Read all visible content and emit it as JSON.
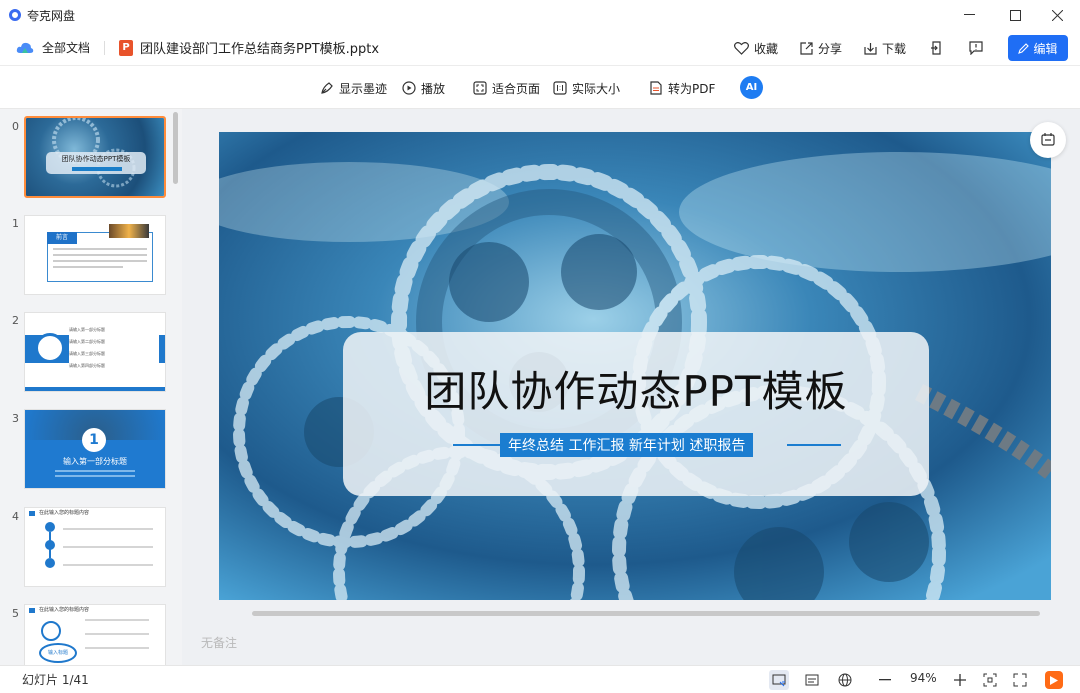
{
  "window": {
    "app_title": "夸克网盘"
  },
  "topbar": {
    "all_docs": "全部文档",
    "file_badge": "P",
    "filename": "团队建设部门工作总结商务PPT模板.pptx",
    "favorite": "收藏",
    "share": "分享",
    "download": "下载",
    "edit": "编辑"
  },
  "toolbar": {
    "show_ink": "显示墨迹",
    "play": "播放",
    "fit_page": "适合页面",
    "actual_size": "实际大小",
    "to_pdf": "转为PDF",
    "ai": "AI"
  },
  "thumbnails": [
    {
      "num": "0",
      "title": "团队协作动态PPT模板"
    },
    {
      "num": "1",
      "title": "前言"
    },
    {
      "num": "2",
      "items": [
        "请输入第一部分标题",
        "请输入第二部分标题",
        "请输入第三部分标题",
        "请输入第四部分标题"
      ]
    },
    {
      "num": "3",
      "badge": "1",
      "title": "输入第一部分标题"
    },
    {
      "num": "4",
      "title": "在此输入您的标题内容"
    },
    {
      "num": "5",
      "title": "在此输入您的标题内容",
      "node": "输入标题"
    }
  ],
  "slide": {
    "title": "团队协作动态PPT模板",
    "subtitle": "年终总结  工作汇报  新年计划  述职报告"
  },
  "notes_placeholder": "无备注",
  "status": {
    "slide_count": "幻灯片 1/41",
    "zoom": "94%"
  },
  "colors": {
    "accent": "#1f6ef5",
    "ppt_badge": "#e8532b",
    "selected_thumb": "#ff8c3b",
    "slide_blue": "#1b7dd0",
    "play_orange": "#ff6b16"
  }
}
